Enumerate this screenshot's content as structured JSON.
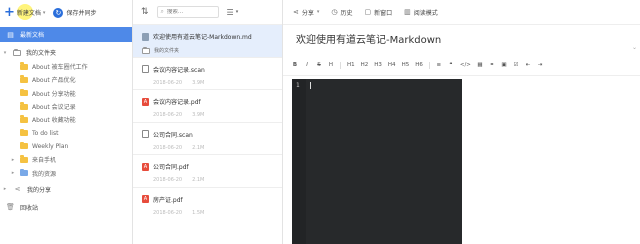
{
  "app": {
    "new_label": "新建文档",
    "sync_label": "保存并同步"
  },
  "sidebar": {
    "latest": "最新文档",
    "my_folders": "我的文件夹",
    "folders": [
      "About 被车圈代工作",
      "About 产品优化",
      "About 分享功能",
      "About 会议记录",
      "About 收藏功能",
      "To do list",
      "Weekly Plan"
    ],
    "from_phone": "来自手机",
    "my_resources": "我的资源",
    "my_shares": "我的分享",
    "trash": "回收站"
  },
  "list": {
    "search_placeholder": "搜索...",
    "notes": [
      {
        "title": "欢迎使用有道云笔记-Markdown.md",
        "sub": "我的文件夹",
        "type": "md"
      },
      {
        "title": "会议内容记录.scan",
        "date": "2018-06-20",
        "size": "3.9M",
        "type": "scan"
      },
      {
        "title": "会议内容记录.pdf",
        "date": "2018-06-20",
        "size": "3.9M",
        "type": "pdf"
      },
      {
        "title": "公司合同.scan",
        "date": "2018-06-20",
        "size": "2.1M",
        "type": "scan"
      },
      {
        "title": "公司合同.pdf",
        "date": "2018-06-20",
        "size": "2.1M",
        "type": "pdf"
      },
      {
        "title": "房产证.pdf",
        "date": "2018-06-20",
        "size": "1.5M",
        "type": "pdf"
      }
    ]
  },
  "editor": {
    "toolbar": {
      "share": "分享",
      "history": "历史",
      "new_window": "新窗口",
      "read_mode": "阅读模式"
    },
    "title": "欢迎使用有道云笔记-Markdown",
    "md_tools": [
      "B",
      "I",
      "S",
      "H",
      "H1",
      "H2",
      "H3",
      "H4",
      "H5",
      "H6",
      "≡",
      "❝",
      "</>",
      "▦",
      "⚭",
      "▣",
      "☑",
      "⇤",
      "⇥"
    ],
    "line_number": "1"
  }
}
